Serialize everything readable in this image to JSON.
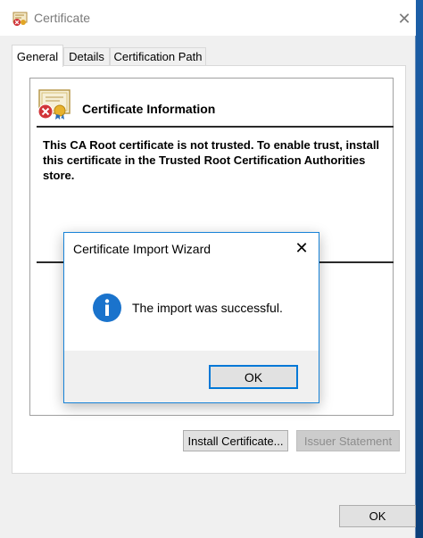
{
  "window": {
    "title": "Certificate",
    "icon": "certificate-icon",
    "close_icon": "close-icon"
  },
  "tabs": [
    {
      "label": "General",
      "active": true
    },
    {
      "label": "Details",
      "active": false
    },
    {
      "label": "Certification Path",
      "active": false
    }
  ],
  "general": {
    "info_title": "Certificate Information",
    "trust_message": "This CA Root certificate is not trusted. To enable trust, install this certificate in the Trusted Root Certification Authorities store.",
    "install_button": "Install Certificate...",
    "issuer_button": "Issuer Statement"
  },
  "footer": {
    "ok_button": "OK"
  },
  "dialog": {
    "title": "Certificate Import Wizard",
    "message": "The import was successful.",
    "ok_button": "OK",
    "icon": "info-icon",
    "close_icon": "close-icon"
  },
  "colors": {
    "accent": "#0078d7",
    "info_icon": "#1a73cc",
    "error_badge": "#d13438"
  }
}
